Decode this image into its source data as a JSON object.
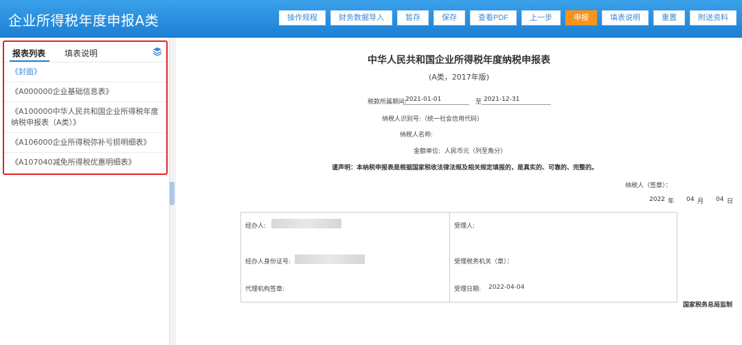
{
  "header": {
    "title": "企业所得税年度申报A类",
    "buttons": [
      "操作规程",
      "财务数据导入",
      "暂存",
      "保存",
      "查看PDF",
      "上一步",
      "申报",
      "填表说明",
      "重置",
      "附送资料"
    ]
  },
  "sidebar": {
    "tabs": [
      "报表列表",
      "填表说明"
    ],
    "items": [
      "《封面》",
      "《A000000企业基础信息表》",
      "《A100000中华人民共和国企业所得税年度纳税申报表（A类）》",
      "《A106000企业所得税弥补亏损明细表》",
      "《A107040减免所得税优惠明细表》"
    ]
  },
  "document": {
    "title": "中华人民共和国企业所得税年度纳税申报表",
    "subtitle": "(A类，2017年版)",
    "period_label": "税款所属期间:",
    "period_start": "2021-01-01",
    "period_to": "至",
    "period_end": "2021-12-31",
    "taxpayer_id_label": "纳税人识别号:（统一社会信用代码）",
    "taxpayer_name_label": "纳税人名称:",
    "unit_label": "金额单位:",
    "unit_value": "人民币元（列至角分）",
    "declaration": "谨声明：本纳税申报表是根据国家税收法律法规及相关规定填报的，是真实的、可靠的、完整的。",
    "signature_label": "纳税人（签章）：",
    "date": {
      "year": "2022",
      "year_unit": "年",
      "month": "04",
      "month_unit": "月",
      "day": "04",
      "day_unit": "日"
    },
    "table": {
      "handler_label": "经办人:",
      "handler_id_label": "经办人身份证号:",
      "agency_label": "代理机构签章:",
      "receiver_label": "受理人:",
      "tax_office_label": "受理税务机关（章）：",
      "receive_date_label": "受理日期:",
      "receive_date": "2022-04-04"
    },
    "footer": "国家税务总局监制"
  },
  "colors": {
    "header": "#1c7fd4",
    "accent": "#f7941d",
    "highlight_border": "#e02020"
  }
}
